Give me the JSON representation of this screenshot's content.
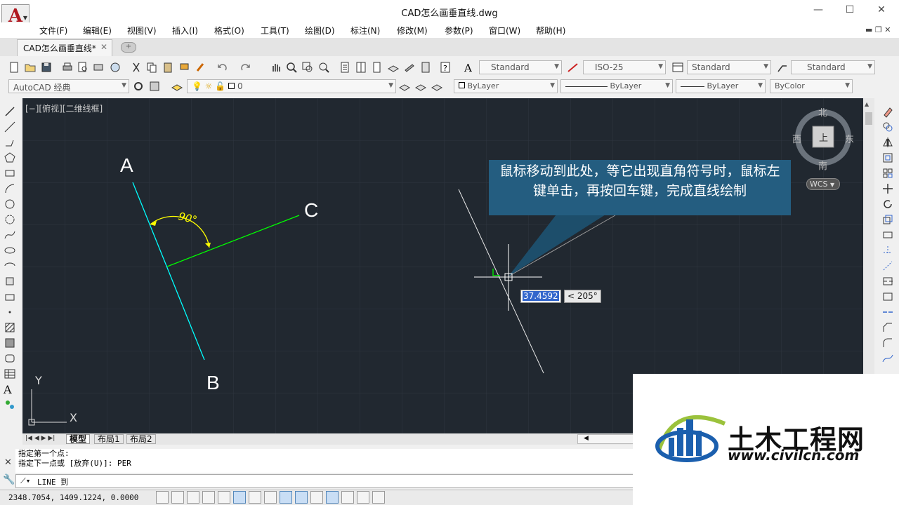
{
  "window": {
    "title": "CAD怎么画垂直线.dwg",
    "minimize": "—",
    "maximize": "☐",
    "close": "✕"
  },
  "menu": [
    "文件(F)",
    "编辑(E)",
    "视图(V)",
    "插入(I)",
    "格式(O)",
    "工具(T)",
    "绘图(D)",
    "标注(N)",
    "修改(M)",
    "参数(P)",
    "窗口(W)",
    "帮助(H)"
  ],
  "tab": {
    "label": "CAD怎么画垂直线*",
    "close": "✕",
    "new": "+"
  },
  "styles": {
    "text_style": "Standard",
    "dim_style": "ISO-25",
    "table_style": "Standard",
    "multileader_style": "Standard"
  },
  "workspace": "AutoCAD 经典",
  "layer": {
    "name": "0"
  },
  "properties": {
    "color": "ByLayer",
    "linetype": "ByLayer",
    "lineweight": "ByLayer",
    "plotstyle": "ByColor"
  },
  "viewport": {
    "label": "[−][俯视][二维线框]"
  },
  "drawing": {
    "label_a": "A",
    "label_b": "B",
    "label_c": "C",
    "angle_label": "90°",
    "callout": "鼠标移动到此处，等它出现直角符号时，鼠标左键单击，再按回车键，完成直线绘制",
    "dyn_length": "37.4592",
    "dyn_angle": "< 205°",
    "ucs_y": "Y",
    "ucs_x": "X"
  },
  "viewcube": {
    "north": "北",
    "south": "南",
    "east": "东",
    "west": "西",
    "top": "上",
    "wcs": "WCS"
  },
  "layout_tabs": [
    "模型",
    "布局1",
    "布局2"
  ],
  "command": {
    "history": [
      "指定第一个点:",
      "指定下一点或 [放弃(U)]: PER"
    ],
    "current": "LINE 到"
  },
  "status": {
    "coords": "2348.7054, 1409.1224, 0.0000"
  },
  "watermark": {
    "name": "土木工程网",
    "url": "www.civilcn.com"
  },
  "colors": {
    "canvas": "#212830",
    "line_ab": "#00ffff",
    "line_c": "#00ff00",
    "angle": "#ffff00",
    "callout": "#245d80"
  }
}
